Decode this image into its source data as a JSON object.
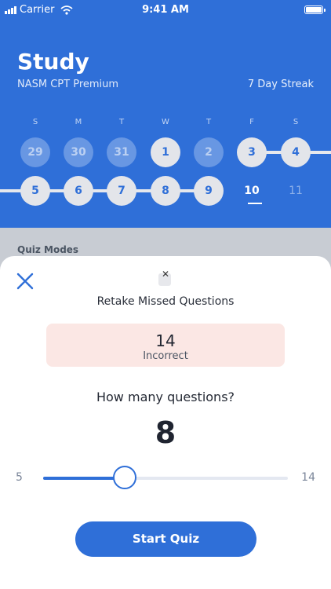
{
  "status_bar": {
    "carrier": "Carrier",
    "time": "9:41 AM"
  },
  "header": {
    "title": "Study",
    "subtitle": "NASM CPT Premium",
    "streak": "7 Day Streak"
  },
  "weekdays": [
    "S",
    "M",
    "T",
    "W",
    "T",
    "F",
    "S"
  ],
  "calendar": {
    "row1": [
      {
        "label": "29",
        "state": "past"
      },
      {
        "label": "30",
        "state": "past"
      },
      {
        "label": "31",
        "state": "past"
      },
      {
        "label": "1",
        "state": "done"
      },
      {
        "label": "2",
        "state": "past"
      },
      {
        "label": "3",
        "state": "done"
      },
      {
        "label": "4",
        "state": "done"
      }
    ],
    "row2": [
      {
        "label": "5",
        "state": "done"
      },
      {
        "label": "6",
        "state": "done"
      },
      {
        "label": "7",
        "state": "done"
      },
      {
        "label": "8",
        "state": "done"
      },
      {
        "label": "9",
        "state": "done"
      },
      {
        "label": "10",
        "state": "today"
      },
      {
        "label": "11",
        "state": "plain"
      }
    ]
  },
  "section": {
    "quiz_modes": "Quiz Modes"
  },
  "sheet": {
    "title": "Retake Missed Questions",
    "incorrect_count": "14",
    "incorrect_label": "Incorrect",
    "question_prompt": "How many questions?",
    "selected_count": "8",
    "slider": {
      "min": "5",
      "max": "14",
      "value": 8
    },
    "start_button": "Start Quiz"
  },
  "colors": {
    "accent": "#2f6fd8",
    "incorrect_bg": "#fbe7e4"
  }
}
